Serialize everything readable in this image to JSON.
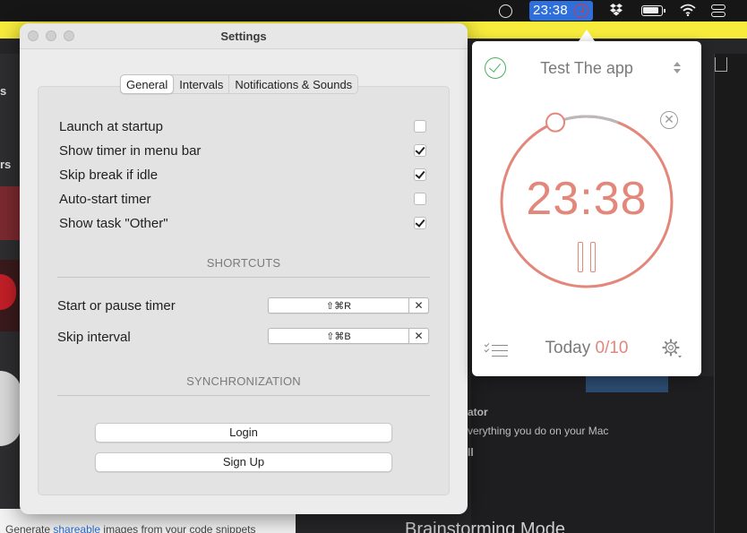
{
  "menubar": {
    "timer": "23:38"
  },
  "background": {
    "bottom_text_prefix": "Generate ",
    "bottom_text_highlight": "shareable",
    "bottom_text_suffix": " images from your code snippets",
    "promo_title": "Brainstorming Mode",
    "promo_line1": "ator",
    "promo_line2": "verything you do on your Mac",
    "promo_line3": "ll"
  },
  "settings": {
    "title": "Settings",
    "tabs": [
      "General",
      "Intervals",
      "Notifications & Sounds"
    ],
    "options": [
      {
        "label": "Launch at startup",
        "checked": false
      },
      {
        "label": "Show timer in menu bar",
        "checked": true
      },
      {
        "label": "Skip break if idle",
        "checked": true
      },
      {
        "label": "Auto-start timer",
        "checked": false
      },
      {
        "label": "Show task \"Other\"",
        "checked": true
      }
    ],
    "shortcuts_header": "SHORTCUTS",
    "shortcuts": [
      {
        "label": "Start or pause timer",
        "keys": "⇧⌘R",
        "clear": "✕"
      },
      {
        "label": "Skip interval",
        "keys": "⇧⌘B",
        "clear": "✕"
      }
    ],
    "sync_header": "SYNCHRONIZATION",
    "login_label": "Login",
    "signup_label": "Sign Up"
  },
  "timer_panel": {
    "task_name": "Test The app",
    "time": "23:38",
    "progress_fraction": 0.06,
    "today_label": "Today",
    "today_count": "0/10",
    "close_glyph": "✕",
    "accent_color": "#e3877b",
    "check_color": "#4caf62"
  }
}
